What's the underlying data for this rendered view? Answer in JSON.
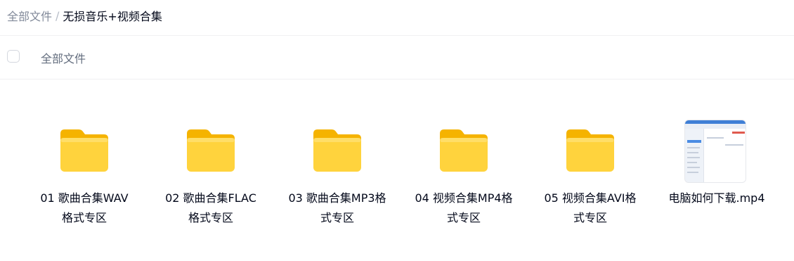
{
  "breadcrumb": {
    "root": "全部文件",
    "separator": "/",
    "current": "无损音乐+视频合集"
  },
  "list_header": {
    "label": "全部文件"
  },
  "items": [
    {
      "name": "01 歌曲合集WAV格式专区",
      "type": "folder",
      "icon": "folder-icon"
    },
    {
      "name": "02 歌曲合集FLAC格式专区",
      "type": "folder",
      "icon": "folder-icon"
    },
    {
      "name": "03 歌曲合集MP3格式专区",
      "type": "folder",
      "icon": "folder-icon"
    },
    {
      "name": "04 视频合集MP4格式专区",
      "type": "folder",
      "icon": "folder-icon"
    },
    {
      "name": "05 视频合集AVI格式专区",
      "type": "folder",
      "icon": "folder-icon"
    },
    {
      "name": "电脑如何下载.mp4",
      "type": "video",
      "icon": "video-thumbnail"
    }
  ],
  "colors": {
    "folder_body": "#ffd33d",
    "folder_back": "#f5b300",
    "text_primary": "#03081a",
    "text_muted": "#818999"
  }
}
